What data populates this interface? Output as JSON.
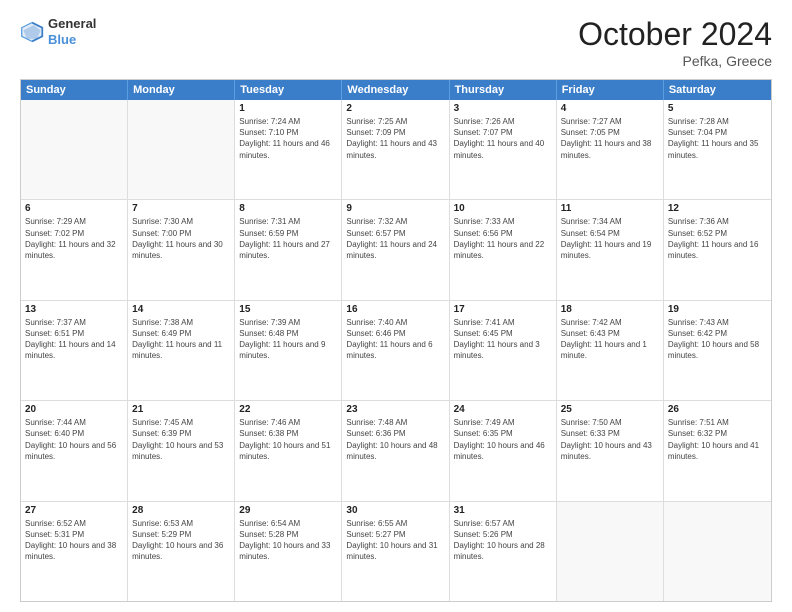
{
  "header": {
    "logo_line1": "General",
    "logo_line2": "Blue",
    "title": "October 2024",
    "subtitle": "Pefka, Greece"
  },
  "days_of_week": [
    "Sunday",
    "Monday",
    "Tuesday",
    "Wednesday",
    "Thursday",
    "Friday",
    "Saturday"
  ],
  "weeks": [
    [
      {
        "day": "",
        "info": ""
      },
      {
        "day": "",
        "info": ""
      },
      {
        "day": "1",
        "info": "Sunrise: 7:24 AM\nSunset: 7:10 PM\nDaylight: 11 hours and 46 minutes."
      },
      {
        "day": "2",
        "info": "Sunrise: 7:25 AM\nSunset: 7:09 PM\nDaylight: 11 hours and 43 minutes."
      },
      {
        "day": "3",
        "info": "Sunrise: 7:26 AM\nSunset: 7:07 PM\nDaylight: 11 hours and 40 minutes."
      },
      {
        "day": "4",
        "info": "Sunrise: 7:27 AM\nSunset: 7:05 PM\nDaylight: 11 hours and 38 minutes."
      },
      {
        "day": "5",
        "info": "Sunrise: 7:28 AM\nSunset: 7:04 PM\nDaylight: 11 hours and 35 minutes."
      }
    ],
    [
      {
        "day": "6",
        "info": "Sunrise: 7:29 AM\nSunset: 7:02 PM\nDaylight: 11 hours and 32 minutes."
      },
      {
        "day": "7",
        "info": "Sunrise: 7:30 AM\nSunset: 7:00 PM\nDaylight: 11 hours and 30 minutes."
      },
      {
        "day": "8",
        "info": "Sunrise: 7:31 AM\nSunset: 6:59 PM\nDaylight: 11 hours and 27 minutes."
      },
      {
        "day": "9",
        "info": "Sunrise: 7:32 AM\nSunset: 6:57 PM\nDaylight: 11 hours and 24 minutes."
      },
      {
        "day": "10",
        "info": "Sunrise: 7:33 AM\nSunset: 6:56 PM\nDaylight: 11 hours and 22 minutes."
      },
      {
        "day": "11",
        "info": "Sunrise: 7:34 AM\nSunset: 6:54 PM\nDaylight: 11 hours and 19 minutes."
      },
      {
        "day": "12",
        "info": "Sunrise: 7:36 AM\nSunset: 6:52 PM\nDaylight: 11 hours and 16 minutes."
      }
    ],
    [
      {
        "day": "13",
        "info": "Sunrise: 7:37 AM\nSunset: 6:51 PM\nDaylight: 11 hours and 14 minutes."
      },
      {
        "day": "14",
        "info": "Sunrise: 7:38 AM\nSunset: 6:49 PM\nDaylight: 11 hours and 11 minutes."
      },
      {
        "day": "15",
        "info": "Sunrise: 7:39 AM\nSunset: 6:48 PM\nDaylight: 11 hours and 9 minutes."
      },
      {
        "day": "16",
        "info": "Sunrise: 7:40 AM\nSunset: 6:46 PM\nDaylight: 11 hours and 6 minutes."
      },
      {
        "day": "17",
        "info": "Sunrise: 7:41 AM\nSunset: 6:45 PM\nDaylight: 11 hours and 3 minutes."
      },
      {
        "day": "18",
        "info": "Sunrise: 7:42 AM\nSunset: 6:43 PM\nDaylight: 11 hours and 1 minute."
      },
      {
        "day": "19",
        "info": "Sunrise: 7:43 AM\nSunset: 6:42 PM\nDaylight: 10 hours and 58 minutes."
      }
    ],
    [
      {
        "day": "20",
        "info": "Sunrise: 7:44 AM\nSunset: 6:40 PM\nDaylight: 10 hours and 56 minutes."
      },
      {
        "day": "21",
        "info": "Sunrise: 7:45 AM\nSunset: 6:39 PM\nDaylight: 10 hours and 53 minutes."
      },
      {
        "day": "22",
        "info": "Sunrise: 7:46 AM\nSunset: 6:38 PM\nDaylight: 10 hours and 51 minutes."
      },
      {
        "day": "23",
        "info": "Sunrise: 7:48 AM\nSunset: 6:36 PM\nDaylight: 10 hours and 48 minutes."
      },
      {
        "day": "24",
        "info": "Sunrise: 7:49 AM\nSunset: 6:35 PM\nDaylight: 10 hours and 46 minutes."
      },
      {
        "day": "25",
        "info": "Sunrise: 7:50 AM\nSunset: 6:33 PM\nDaylight: 10 hours and 43 minutes."
      },
      {
        "day": "26",
        "info": "Sunrise: 7:51 AM\nSunset: 6:32 PM\nDaylight: 10 hours and 41 minutes."
      }
    ],
    [
      {
        "day": "27",
        "info": "Sunrise: 6:52 AM\nSunset: 5:31 PM\nDaylight: 10 hours and 38 minutes."
      },
      {
        "day": "28",
        "info": "Sunrise: 6:53 AM\nSunset: 5:29 PM\nDaylight: 10 hours and 36 minutes."
      },
      {
        "day": "29",
        "info": "Sunrise: 6:54 AM\nSunset: 5:28 PM\nDaylight: 10 hours and 33 minutes."
      },
      {
        "day": "30",
        "info": "Sunrise: 6:55 AM\nSunset: 5:27 PM\nDaylight: 10 hours and 31 minutes."
      },
      {
        "day": "31",
        "info": "Sunrise: 6:57 AM\nSunset: 5:26 PM\nDaylight: 10 hours and 28 minutes."
      },
      {
        "day": "",
        "info": ""
      },
      {
        "day": "",
        "info": ""
      }
    ]
  ]
}
